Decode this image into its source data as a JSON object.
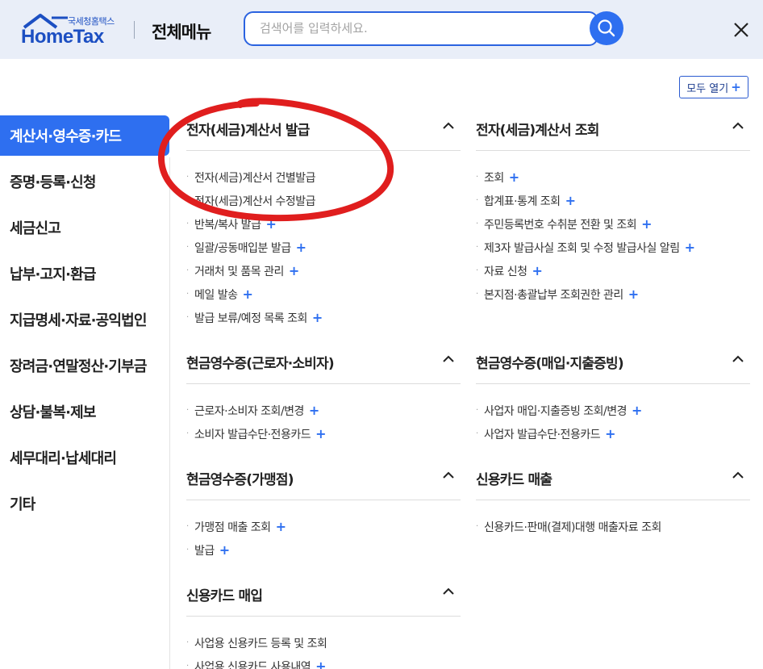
{
  "header": {
    "logo_sub": "국세청홈택스",
    "logo_main": "HomeTax",
    "menu_title": "전체메뉴",
    "search_placeholder": "검색어를 입력하세요.",
    "search_icon": "search-icon",
    "close_icon": "close-icon"
  },
  "expand_all": {
    "label": "모두 열기",
    "plus": "+"
  },
  "sidebar": {
    "items": [
      {
        "label": "계산서·영수증·카드",
        "active": true
      },
      {
        "label": "증명·등록·신청"
      },
      {
        "label": "세금신고"
      },
      {
        "label": "납부·고지·환급"
      },
      {
        "label": "지급명세·자료·공익법인"
      },
      {
        "label": "장려금·연말정산·기부금"
      },
      {
        "label": "상담·불복·제보"
      },
      {
        "label": "세무대리·납세대리"
      },
      {
        "label": "기타"
      }
    ]
  },
  "sections": [
    {
      "title": "전자(세금)계산서 발급",
      "items": [
        {
          "label": "전자(세금)계산서 건별발급",
          "plus": false
        },
        {
          "label": "전자(세금)계산서 수정발급",
          "plus": false
        },
        {
          "label": "반복/복사 발급",
          "plus": true
        },
        {
          "label": "일괄/공동매입분 발급",
          "plus": true
        },
        {
          "label": "거래처 및 품목 관리",
          "plus": true
        },
        {
          "label": "메일 발송",
          "plus": true
        },
        {
          "label": "발급 보류/예정 목록 조회",
          "plus": true
        }
      ]
    },
    {
      "title": "전자(세금)계산서 조회",
      "items": [
        {
          "label": "조회",
          "plus": true
        },
        {
          "label": "합계표·통계 조회",
          "plus": true
        },
        {
          "label": "주민등록번호 수취분 전환 및 조회",
          "plus": true
        },
        {
          "label": "제3자 발급사실 조회 및 수정 발급사실 알림",
          "plus": true
        },
        {
          "label": "자료 신청",
          "plus": true
        },
        {
          "label": "본지점·총괄납부 조회권한 관리",
          "plus": true
        }
      ]
    },
    {
      "title": "현금영수증(근로자·소비자)",
      "items": [
        {
          "label": "근로자·소비자 조회/변경",
          "plus": true
        },
        {
          "label": "소비자 발급수단·전용카드",
          "plus": true
        }
      ]
    },
    {
      "title": "현금영수증(매입·지출증빙)",
      "items": [
        {
          "label": "사업자 매입·지출증빙 조회/변경",
          "plus": true
        },
        {
          "label": "사업자 발급수단·전용카드",
          "plus": true
        }
      ]
    },
    {
      "title": "현금영수증(가맹점)",
      "items": [
        {
          "label": "가맹점 매출 조회",
          "plus": true
        },
        {
          "label": "발급",
          "plus": true
        }
      ]
    },
    {
      "title": "신용카드 매출",
      "items": [
        {
          "label": "신용카드·판매(결제)대행 매출자료 조회",
          "plus": false
        }
      ]
    },
    {
      "title": "신용카드 매입",
      "items": [
        {
          "label": "사업용 신용카드 등록 및 조회",
          "plus": false
        },
        {
          "label": "사업용 신용카드 사용내역",
          "plus": true
        }
      ]
    }
  ],
  "colors": {
    "accent": "#2e6ff0",
    "annotation": "#e01e1e",
    "header_bg": "#e9eef8"
  }
}
